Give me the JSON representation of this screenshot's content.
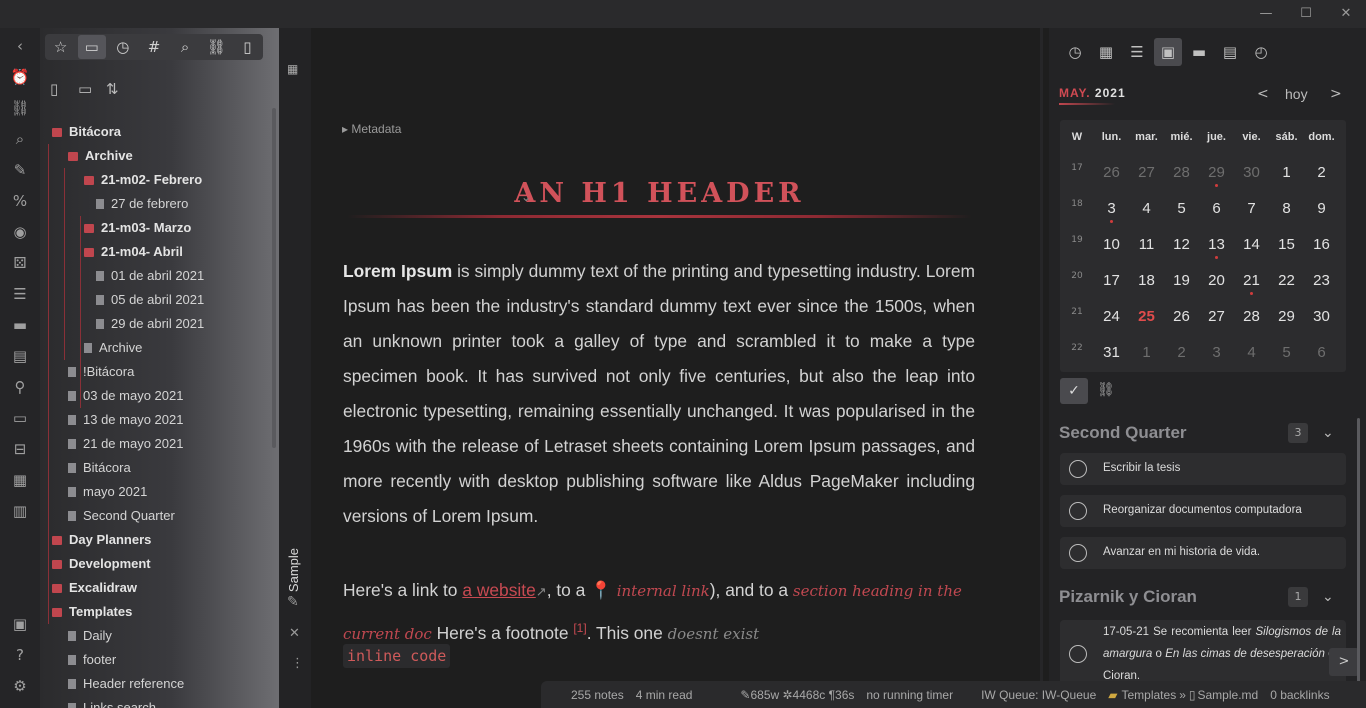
{
  "window": {
    "minimize": "—",
    "maximize": "☐",
    "close": "✕"
  },
  "ribbon": [
    "collapse-left",
    "alarm",
    "graph-link",
    "search",
    "pencil",
    "percent-code",
    "record",
    "dice",
    "list",
    "markdown",
    "form",
    "network",
    "cards",
    "inbox",
    "table",
    "calendar"
  ],
  "sidebar": {
    "tabs": [
      "star",
      "folder",
      "clock",
      "hash",
      "search",
      "link",
      "file"
    ],
    "file_actions": [
      "new-note",
      "new-folder",
      "sort"
    ],
    "tree": [
      {
        "label": "Bitácora",
        "type": "folder",
        "level": 0
      },
      {
        "label": "Archive",
        "type": "folder",
        "level": 1
      },
      {
        "label": "21-m02- Febrero",
        "type": "folder",
        "level": 2
      },
      {
        "label": "27 de febrero",
        "type": "file",
        "level": 3
      },
      {
        "label": "21-m03- Marzo",
        "type": "folder",
        "level": 2
      },
      {
        "label": "21-m04- Abril",
        "type": "folder",
        "level": 2
      },
      {
        "label": "01 de abril 2021",
        "type": "file",
        "level": 3
      },
      {
        "label": "05 de abril 2021",
        "type": "file",
        "level": 3
      },
      {
        "label": "29 de abril 2021",
        "type": "file",
        "level": 3
      },
      {
        "label": "Archive",
        "type": "file",
        "level": 2
      },
      {
        "label": "!Bitácora",
        "type": "file",
        "level": 1
      },
      {
        "label": "03 de mayo 2021",
        "type": "file",
        "level": 1
      },
      {
        "label": "13 de mayo 2021",
        "type": "file",
        "level": 1
      },
      {
        "label": "21 de mayo 2021",
        "type": "file",
        "level": 1
      },
      {
        "label": "Bitácora",
        "type": "file",
        "level": 1
      },
      {
        "label": "mayo 2021",
        "type": "file",
        "level": 1
      },
      {
        "label": "Second Quarter",
        "type": "file",
        "level": 1
      },
      {
        "label": "Day Planners",
        "type": "folder",
        "level": 0
      },
      {
        "label": "Development",
        "type": "folder",
        "level": 0
      },
      {
        "label": "Excalidraw",
        "type": "folder",
        "level": 0
      },
      {
        "label": "Templates",
        "type": "folder",
        "level": 0
      },
      {
        "label": "Daily",
        "type": "file",
        "level": 1
      },
      {
        "label": "footer",
        "type": "file",
        "level": 1
      },
      {
        "label": "Header reference",
        "type": "file",
        "level": 1
      },
      {
        "label": "Links search",
        "type": "file",
        "level": 1
      }
    ]
  },
  "editor": {
    "tab_label": "Sample",
    "metadata": "Metadata",
    "h1": "AN H1 HEADER",
    "para_bold": "Lorem Ipsum",
    "para_rest": " is simply dummy text of the printing and typesetting industry. Lorem Ipsum has been the industry's standard dummy text ever since the 1500s, when an unknown printer took a galley of type and scrambled it to make a type specimen book. It has survived not only five centuries, but also the leap into electronic typesetting, remaining essentially unchanged. It was popularised in the 1960s with the release of Letraset sheets containing Lorem Ipsum passages, and more recently with desktop publishing software like Aldus PageMaker including versions of Lorem Ipsum.",
    "l1": "Here's a link to ",
    "l_website": "a website",
    "l_ext": "↗",
    "l2": ", to a ",
    "l_internal": "internal link",
    "l3": "), and to a ",
    "l_section": "section heading in the current doc",
    "l4": " Here's a footnote ",
    "l_fn": "[1]",
    "l5": ". This one ",
    "l_dne": "doesnt exist",
    "code": "inline code"
  },
  "calendar": {
    "month": "MAY.",
    "year": "2021",
    "today_label": "hoy",
    "headers": [
      "W",
      "lun.",
      "mar.",
      "mié.",
      "jue.",
      "vie.",
      "sáb.",
      "dom."
    ],
    "weeks": [
      {
        "w": "17",
        "days": [
          "26",
          "27",
          "28",
          "29",
          "30",
          "1",
          "2"
        ]
      },
      {
        "w": "18",
        "days": [
          "3",
          "4",
          "5",
          "6",
          "7",
          "8",
          "9"
        ]
      },
      {
        "w": "19",
        "days": [
          "10",
          "11",
          "12",
          "13",
          "14",
          "15",
          "16"
        ]
      },
      {
        "w": "20",
        "days": [
          "17",
          "18",
          "19",
          "20",
          "21",
          "22",
          "23"
        ]
      },
      {
        "w": "21",
        "days": [
          "24",
          "25",
          "26",
          "27",
          "28",
          "29",
          "30"
        ]
      },
      {
        "w": "22",
        "days": [
          "31",
          "1",
          "2",
          "3",
          "4",
          "5",
          "6"
        ]
      }
    ],
    "accent": "#d04a52"
  },
  "tasks": {
    "group1": {
      "title": "Second Quarter",
      "count": "3",
      "items": [
        "Escribir la tesis",
        "Reorganizar documentos computadora",
        "Avanzar en mi historia de vida."
      ]
    },
    "group2": {
      "title": "Pizarnik y Cioran",
      "count": "1",
      "item_a": "17-05-21 Se recomienta leer ",
      "item_b": "Silogismos de la amargura",
      "item_c": " o ",
      "item_d": "En las cimas de desesperación",
      "item_e": " de Cioran."
    }
  },
  "status": {
    "notes": "255 notes",
    "read": "4 min read",
    "counts": "✎685w ✲4468c ¶36s",
    "timer": "no running timer",
    "queue": "IW Queue: IW-Queue",
    "path_folder": "Templates",
    "path_sep": "»",
    "path_file": "Sample.md",
    "backlinks": "0 backlinks"
  }
}
